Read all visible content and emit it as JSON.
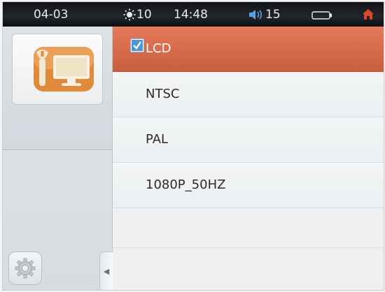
{
  "statusbar": {
    "date": "04-03",
    "brightness_icon": "sun-icon",
    "brightness": "10",
    "time": "14:48",
    "volume_icon": "speaker-icon",
    "volume": "15",
    "battery_icon": "battery-icon",
    "home_icon": "home-icon"
  },
  "sidebar": {
    "app_icon": "settings-tools-icon",
    "gear_icon": "gear-icon",
    "collapse_arrow": "◀"
  },
  "options": [
    {
      "label": "LCD",
      "selected": true
    },
    {
      "label": "NTSC",
      "selected": false
    },
    {
      "label": "PAL",
      "selected": false
    },
    {
      "label": "1080P_50HZ",
      "selected": false
    }
  ],
  "colors": {
    "selected_row": "#d56b4b",
    "statusbar": "#1a1c20",
    "home_icon": "#d9482b"
  }
}
